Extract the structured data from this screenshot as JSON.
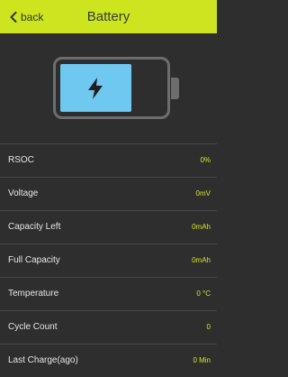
{
  "header": {
    "back_label": "back",
    "title": "Battery",
    "accent_color": "#cce51f"
  },
  "battery_graphic": {
    "icon": "lightning-bolt-icon",
    "fill_color": "#6fc8f0"
  },
  "rows": [
    {
      "label": "RSOC",
      "value": "0%"
    },
    {
      "label": "Voltage",
      "value": "0mV"
    },
    {
      "label": "Capacity Left",
      "value": "0mAh"
    },
    {
      "label": "Full Capacity",
      "value": "0mAh"
    },
    {
      "label": "Temperature",
      "value": "0 °C"
    },
    {
      "label": "Cycle Count",
      "value": "0"
    },
    {
      "label": "Last Charge(ago)",
      "value": "0 Min"
    }
  ]
}
